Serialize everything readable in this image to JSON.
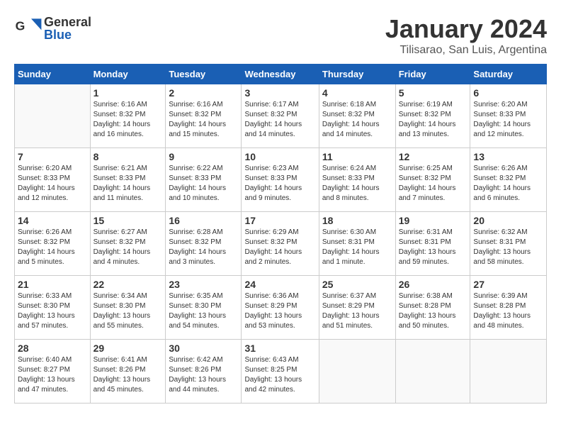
{
  "logo": {
    "general": "General",
    "blue": "Blue"
  },
  "title": "January 2024",
  "location": "Tilisarao, San Luis, Argentina",
  "weekdays": [
    "Sunday",
    "Monday",
    "Tuesday",
    "Wednesday",
    "Thursday",
    "Friday",
    "Saturday"
  ],
  "weeks": [
    [
      {
        "day": "",
        "info": ""
      },
      {
        "day": "1",
        "info": "Sunrise: 6:16 AM\nSunset: 8:32 PM\nDaylight: 14 hours\nand 16 minutes."
      },
      {
        "day": "2",
        "info": "Sunrise: 6:16 AM\nSunset: 8:32 PM\nDaylight: 14 hours\nand 15 minutes."
      },
      {
        "day": "3",
        "info": "Sunrise: 6:17 AM\nSunset: 8:32 PM\nDaylight: 14 hours\nand 14 minutes."
      },
      {
        "day": "4",
        "info": "Sunrise: 6:18 AM\nSunset: 8:32 PM\nDaylight: 14 hours\nand 14 minutes."
      },
      {
        "day": "5",
        "info": "Sunrise: 6:19 AM\nSunset: 8:32 PM\nDaylight: 14 hours\nand 13 minutes."
      },
      {
        "day": "6",
        "info": "Sunrise: 6:20 AM\nSunset: 8:33 PM\nDaylight: 14 hours\nand 12 minutes."
      }
    ],
    [
      {
        "day": "7",
        "info": "Sunrise: 6:20 AM\nSunset: 8:33 PM\nDaylight: 14 hours\nand 12 minutes."
      },
      {
        "day": "8",
        "info": "Sunrise: 6:21 AM\nSunset: 8:33 PM\nDaylight: 14 hours\nand 11 minutes."
      },
      {
        "day": "9",
        "info": "Sunrise: 6:22 AM\nSunset: 8:33 PM\nDaylight: 14 hours\nand 10 minutes."
      },
      {
        "day": "10",
        "info": "Sunrise: 6:23 AM\nSunset: 8:33 PM\nDaylight: 14 hours\nand 9 minutes."
      },
      {
        "day": "11",
        "info": "Sunrise: 6:24 AM\nSunset: 8:33 PM\nDaylight: 14 hours\nand 8 minutes."
      },
      {
        "day": "12",
        "info": "Sunrise: 6:25 AM\nSunset: 8:32 PM\nDaylight: 14 hours\nand 7 minutes."
      },
      {
        "day": "13",
        "info": "Sunrise: 6:26 AM\nSunset: 8:32 PM\nDaylight: 14 hours\nand 6 minutes."
      }
    ],
    [
      {
        "day": "14",
        "info": "Sunrise: 6:26 AM\nSunset: 8:32 PM\nDaylight: 14 hours\nand 5 minutes."
      },
      {
        "day": "15",
        "info": "Sunrise: 6:27 AM\nSunset: 8:32 PM\nDaylight: 14 hours\nand 4 minutes."
      },
      {
        "day": "16",
        "info": "Sunrise: 6:28 AM\nSunset: 8:32 PM\nDaylight: 14 hours\nand 3 minutes."
      },
      {
        "day": "17",
        "info": "Sunrise: 6:29 AM\nSunset: 8:32 PM\nDaylight: 14 hours\nand 2 minutes."
      },
      {
        "day": "18",
        "info": "Sunrise: 6:30 AM\nSunset: 8:31 PM\nDaylight: 14 hours\nand 1 minute."
      },
      {
        "day": "19",
        "info": "Sunrise: 6:31 AM\nSunset: 8:31 PM\nDaylight: 13 hours\nand 59 minutes."
      },
      {
        "day": "20",
        "info": "Sunrise: 6:32 AM\nSunset: 8:31 PM\nDaylight: 13 hours\nand 58 minutes."
      }
    ],
    [
      {
        "day": "21",
        "info": "Sunrise: 6:33 AM\nSunset: 8:30 PM\nDaylight: 13 hours\nand 57 minutes."
      },
      {
        "day": "22",
        "info": "Sunrise: 6:34 AM\nSunset: 8:30 PM\nDaylight: 13 hours\nand 55 minutes."
      },
      {
        "day": "23",
        "info": "Sunrise: 6:35 AM\nSunset: 8:30 PM\nDaylight: 13 hours\nand 54 minutes."
      },
      {
        "day": "24",
        "info": "Sunrise: 6:36 AM\nSunset: 8:29 PM\nDaylight: 13 hours\nand 53 minutes."
      },
      {
        "day": "25",
        "info": "Sunrise: 6:37 AM\nSunset: 8:29 PM\nDaylight: 13 hours\nand 51 minutes."
      },
      {
        "day": "26",
        "info": "Sunrise: 6:38 AM\nSunset: 8:28 PM\nDaylight: 13 hours\nand 50 minutes."
      },
      {
        "day": "27",
        "info": "Sunrise: 6:39 AM\nSunset: 8:28 PM\nDaylight: 13 hours\nand 48 minutes."
      }
    ],
    [
      {
        "day": "28",
        "info": "Sunrise: 6:40 AM\nSunset: 8:27 PM\nDaylight: 13 hours\nand 47 minutes."
      },
      {
        "day": "29",
        "info": "Sunrise: 6:41 AM\nSunset: 8:26 PM\nDaylight: 13 hours\nand 45 minutes."
      },
      {
        "day": "30",
        "info": "Sunrise: 6:42 AM\nSunset: 8:26 PM\nDaylight: 13 hours\nand 44 minutes."
      },
      {
        "day": "31",
        "info": "Sunrise: 6:43 AM\nSunset: 8:25 PM\nDaylight: 13 hours\nand 42 minutes."
      },
      {
        "day": "",
        "info": ""
      },
      {
        "day": "",
        "info": ""
      },
      {
        "day": "",
        "info": ""
      }
    ]
  ]
}
